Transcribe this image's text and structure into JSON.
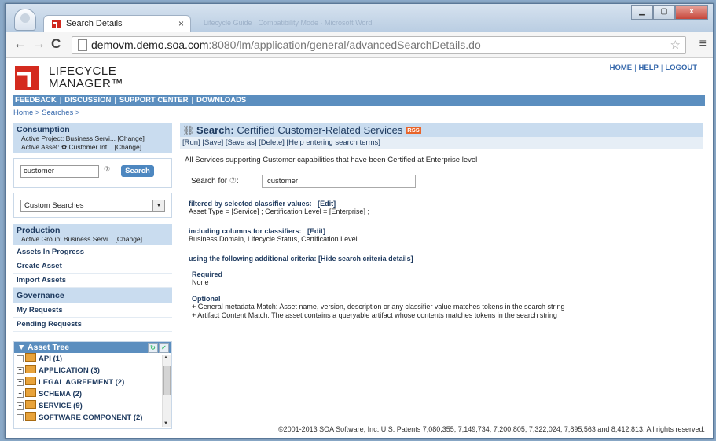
{
  "browser": {
    "tab_title": "Search Details",
    "tab_close": "×",
    "bg_tab_text": "Lifecycle Guide · Compatibility Mode · Microsoft Word",
    "url_host": "demovm.demo.soa.com",
    "url_rest": ":8080/lm/application/general/advancedSearchDetails.do"
  },
  "app": {
    "logo_line1": "LIFECYCLE",
    "logo_line2": "MANAGER™",
    "top_links": [
      "HOME",
      "HELP",
      "LOGOUT"
    ],
    "nav_links": [
      "FEEDBACK",
      "DISCUSSION",
      "SUPPORT CENTER",
      "DOWNLOADS"
    ],
    "breadcrumb": "Home > Searches >"
  },
  "sidebar": {
    "consumption_title": "Consumption",
    "active_project": "Active Project: Business Servi... [Change]",
    "active_asset": "Active Asset: ✿ Customer Inf... [Change]",
    "search_value": "customer",
    "search_button": "Search",
    "custom_searches": "Custom Searches",
    "production_title": "Production",
    "active_group": "Active Group: Business Servi... [Change]",
    "production_links": [
      "Assets In Progress",
      "Create Asset",
      "Import Assets"
    ],
    "governance_title": "Governance",
    "governance_links": [
      "My Requests",
      "Pending Requests"
    ],
    "asset_tree_title": "Asset Tree",
    "tree_items": [
      "API (1)",
      "APPLICATION (3)",
      "LEGAL AGREEMENT (2)",
      "SCHEMA (2)",
      "SERVICE (9)",
      "SOFTWARE COMPONENT (2)"
    ]
  },
  "main": {
    "title_prefix": "Search:",
    "title": "Certified Customer-Related Services",
    "rss": "RSS",
    "actions": "[Run]  [Save]  [Save as]  [Delete]  [Help entering search terms]",
    "description": "All Services supporting Customer capabilities that have been Certified at Enterprise level",
    "search_for_label": "Search for",
    "search_for_value": "customer",
    "filtered_heading": "filtered by selected classifier values:",
    "filtered_edit": "[Edit]",
    "filtered_text": "Asset Type = [Service] ; Certification Level = [Enterprise] ;",
    "columns_heading": "including columns for classifiers:",
    "columns_edit": "[Edit]",
    "columns_text": "Business Domain, Lifecycle Status, Certification Level",
    "criteria_heading": "using the following additional criteria:",
    "criteria_link": "[Hide search criteria details]",
    "required_label": "Required",
    "required_value": "None",
    "optional_label": "Optional",
    "optional_1": "+ General metadata Match: Asset name, version, description or any classifier value matches tokens in the search string",
    "optional_2": "+ Artifact Content Match: The asset contains a queryable artifact whose contents matches tokens in the search string"
  },
  "footer": "©2001-2013 SOA Software, Inc. U.S. Patents 7,080,355, 7,149,734, 7,200,805, 7,322,024, 7,895,563 and 8,412,813. All rights reserved.",
  "colors": {
    "accent": "#5b8ebf",
    "panel": "#c9dcef",
    "link": "#1e3a5f",
    "rss": "#e8642a"
  }
}
